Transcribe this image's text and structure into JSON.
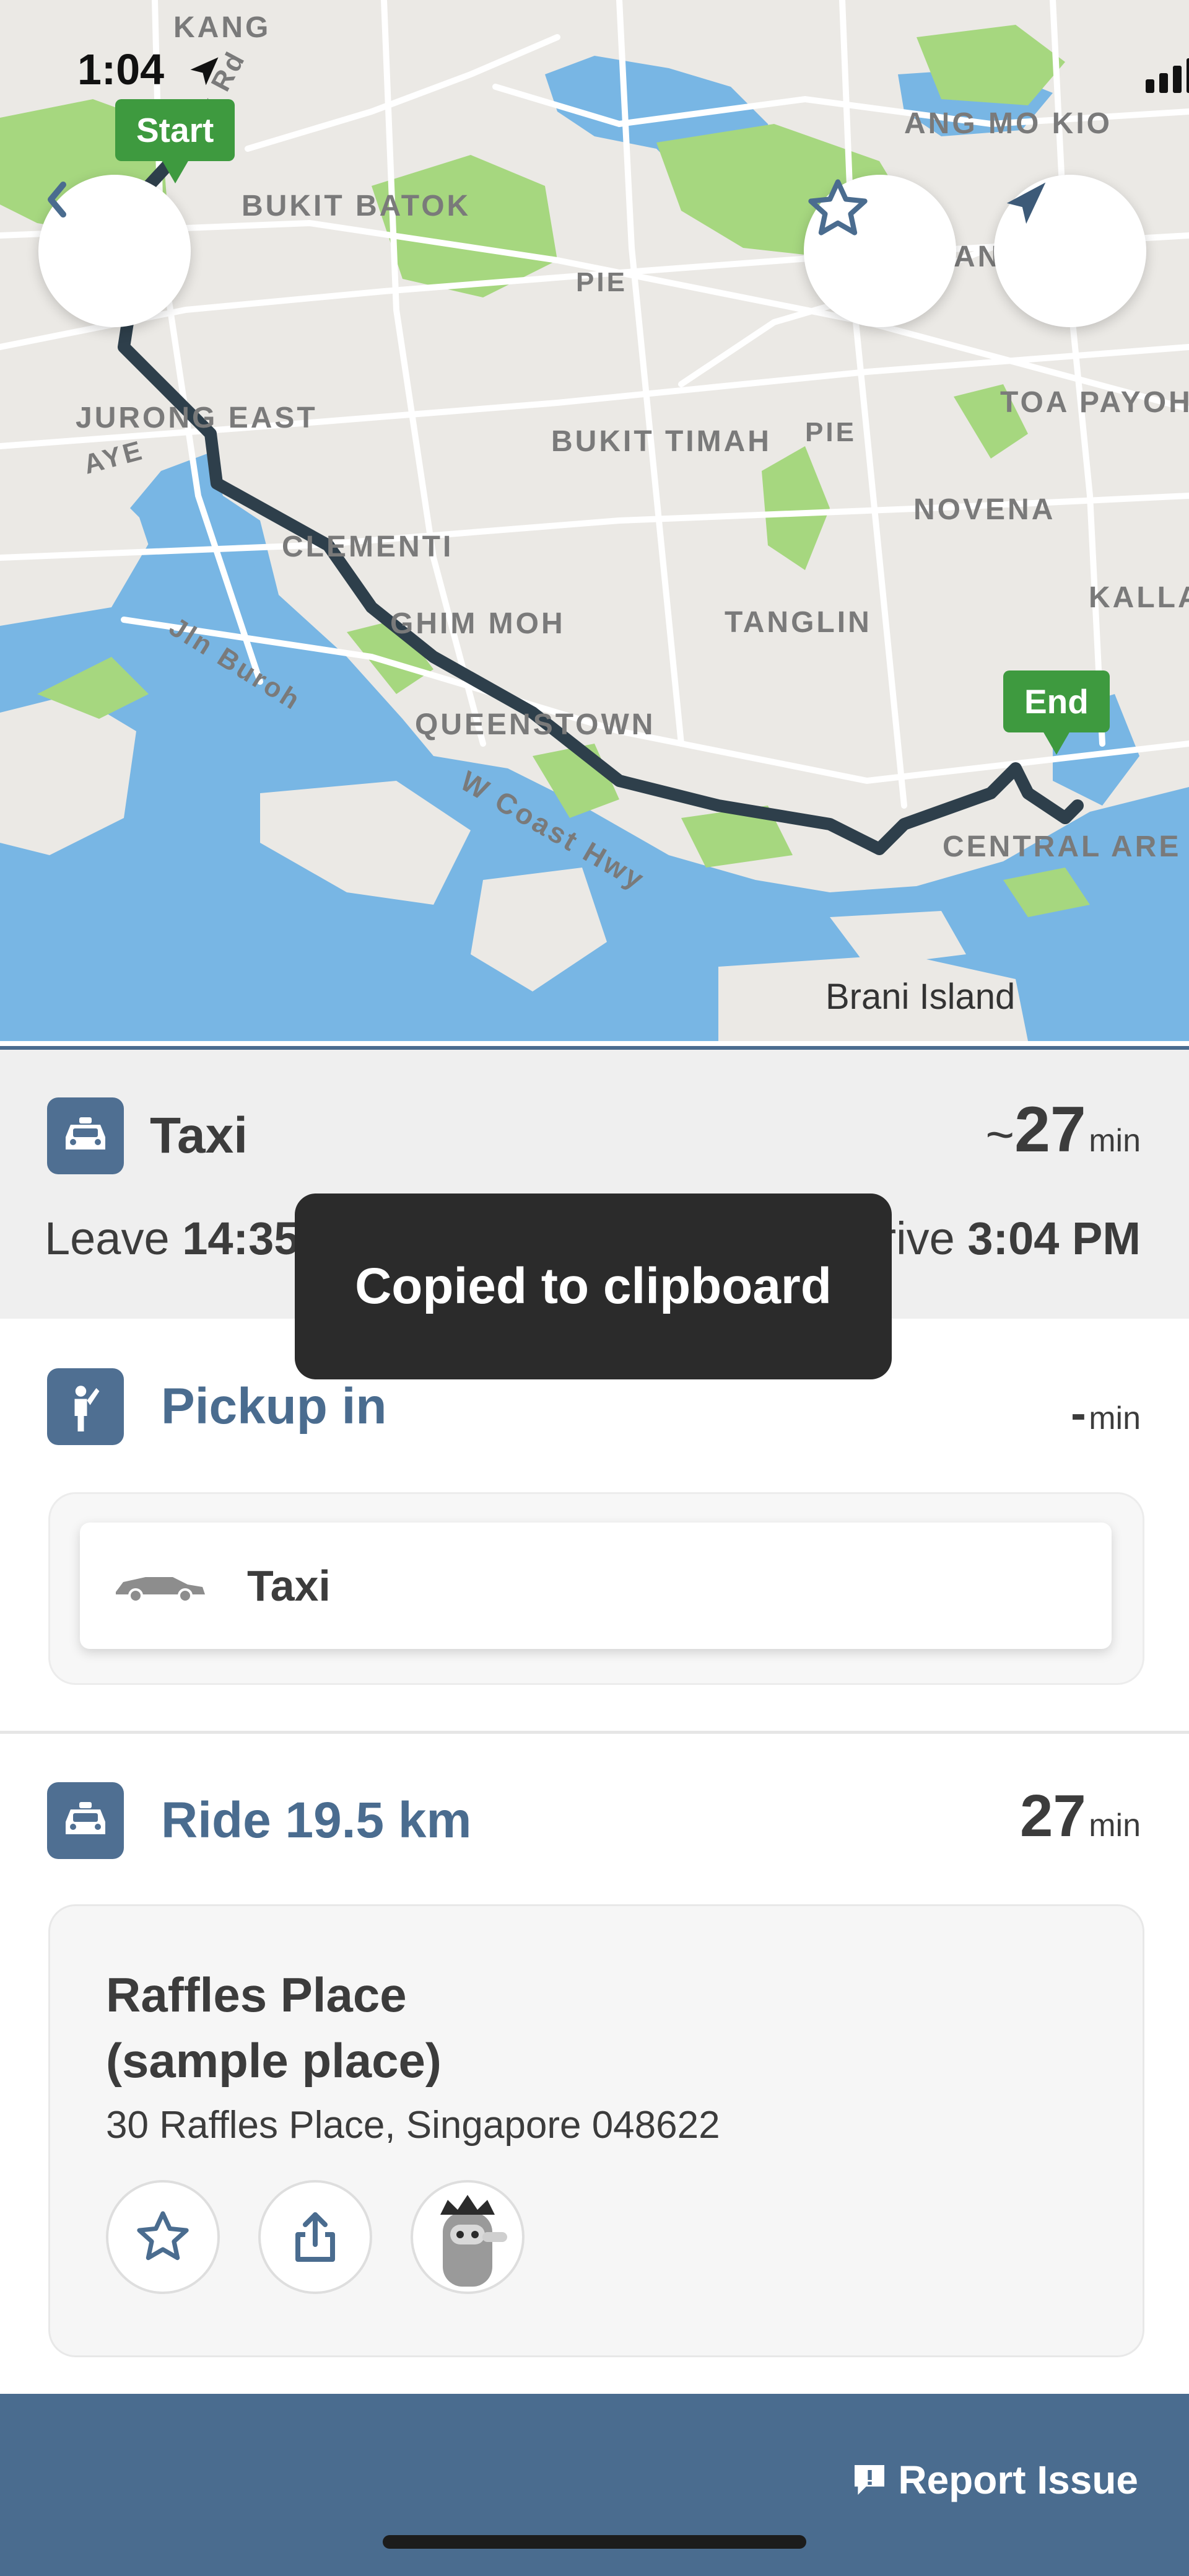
{
  "status_bar": {
    "time": "1:04"
  },
  "map": {
    "start_label": "Start",
    "end_label": "End",
    "places": [
      "KANG",
      "ANG MO KIO",
      "BUKIT BATOK",
      "JURONG EAST",
      "AYE",
      "BUKIT TIMAH",
      "PIE",
      "PIE",
      "TOA PAYOH",
      "NOVENA",
      "CLEMENTI",
      "Jln Buroh",
      "GHIM MOH",
      "TANGLIN",
      "KALLA",
      "QUEENSTOWN",
      "W Coast Hwy",
      "CENTRAL ARE",
      "Brani Island",
      "k Rd",
      "AN"
    ]
  },
  "summary": {
    "mode": "Taxi",
    "duration_prefix": "~",
    "duration": "27",
    "duration_unit": "min",
    "leave_label": "Leave",
    "leave_time": "14:35",
    "arrive_label": "Arrive",
    "arrive_time": "3:04 PM"
  },
  "toast": {
    "text": "Copied to clipboard"
  },
  "pickup": {
    "label": "Pickup in",
    "value": "-",
    "unit": "min",
    "option_label": "Taxi"
  },
  "ride": {
    "label": "Ride 19.5 km",
    "duration": "27",
    "unit": "min",
    "destination_name_1": "Raffles Place",
    "destination_name_2": "(sample place)",
    "destination_address": "30 Raffles Place, Singapore 048622"
  },
  "footer": {
    "report_label": "Report Issue"
  },
  "colors": {
    "accent": "#4a6c8f",
    "route": "#2e3f4b",
    "pin": "#3e9a3f",
    "water": "#78b6e4",
    "park": "#a6d77f",
    "toast": "#2b2b2b"
  }
}
